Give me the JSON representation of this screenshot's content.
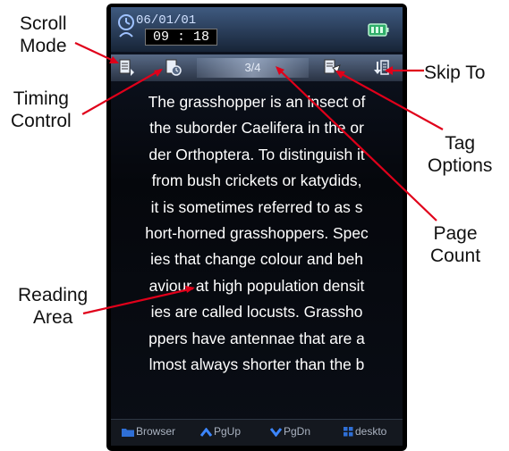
{
  "callouts": {
    "scroll_mode": [
      "Scroll",
      "Mode"
    ],
    "timing_control": [
      "Timing",
      "Control"
    ],
    "reading_area": [
      "Reading",
      "Area"
    ],
    "skip_to": [
      "Skip To"
    ],
    "tag_options": [
      "Tag",
      "Options"
    ],
    "page_count": [
      "Page",
      "Count"
    ]
  },
  "status": {
    "date": "06/01/01",
    "time": "09 : 18"
  },
  "toolbar": {
    "page": "3/4"
  },
  "reading_lines": [
    "The grasshopper is an insect of",
    "the suborder Caelifera in the or",
    "der Orthoptera. To distinguish it",
    "from bush crickets or katydids,",
    "it is sometimes referred to as s",
    "hort-horned grasshoppers. Spec",
    "ies that change colour and beh",
    "aviour at high population densit",
    "ies are called locusts. Grassho",
    "ppers have antennae that are a",
    "lmost always shorter than the b"
  ],
  "bottom_bar": {
    "browser": "Browser",
    "pgup": "PgUp",
    "pgdn": "PgDn",
    "desktop": "deskto"
  },
  "colors": {
    "accent": "#3f5a80",
    "arrow": "#e0001a"
  },
  "icons": [
    "clock-icon",
    "battery-icon",
    "scroll-mode-icon",
    "timing-icon",
    "tag-icon",
    "skip-to-icon",
    "folder-icon",
    "up-arrow-icon",
    "down-arrow-icon",
    "grid-icon"
  ]
}
